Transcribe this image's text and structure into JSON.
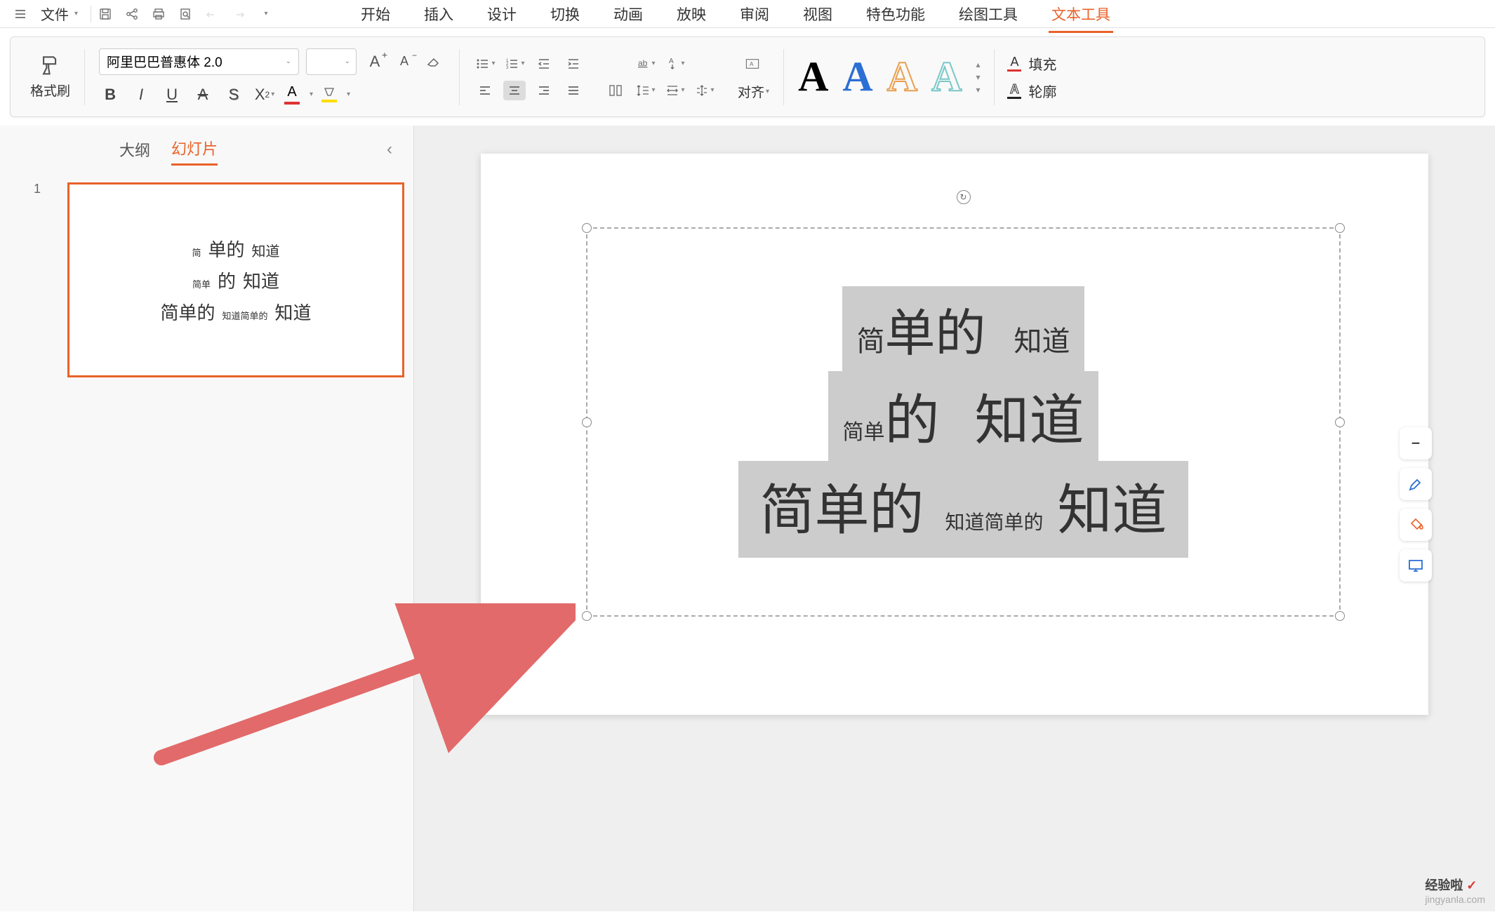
{
  "topbar": {
    "file_label": "文件"
  },
  "menu": {
    "start": "开始",
    "insert": "插入",
    "design": "设计",
    "transition": "切换",
    "animation": "动画",
    "slideshow": "放映",
    "review": "审阅",
    "view": "视图",
    "features": "特色功能",
    "drawing": "绘图工具",
    "text_tools": "文本工具"
  },
  "ribbon": {
    "format_brush": "格式刷",
    "font_name": "阿里巴巴普惠体 2.0",
    "font_size": "",
    "align_label": "对齐",
    "fill_label": "填充",
    "outline_label": "轮廓"
  },
  "side": {
    "outline_tab": "大纲",
    "slides_tab": "幻灯片",
    "slide_number": "1"
  },
  "thumb": {
    "l1_a": "简",
    "l1_b": "单的",
    "l1_c": "知道",
    "l2_a": "简单",
    "l2_b": "的",
    "l2_c": "知道",
    "l3_a": "简单的",
    "l3_b": "知道简单的",
    "l3_c": "知道"
  },
  "slide_text": {
    "r1_a": "简",
    "r1_b": "单的",
    "r1_c": "知道",
    "r2_a": "简单",
    "r2_b": "的",
    "r2_c": "知道",
    "r3_a": "简单的",
    "r3_b": "知道简单的",
    "r3_c": "知道"
  },
  "watermark": {
    "brand": "经验啦",
    "url": "jingyanla.com"
  }
}
